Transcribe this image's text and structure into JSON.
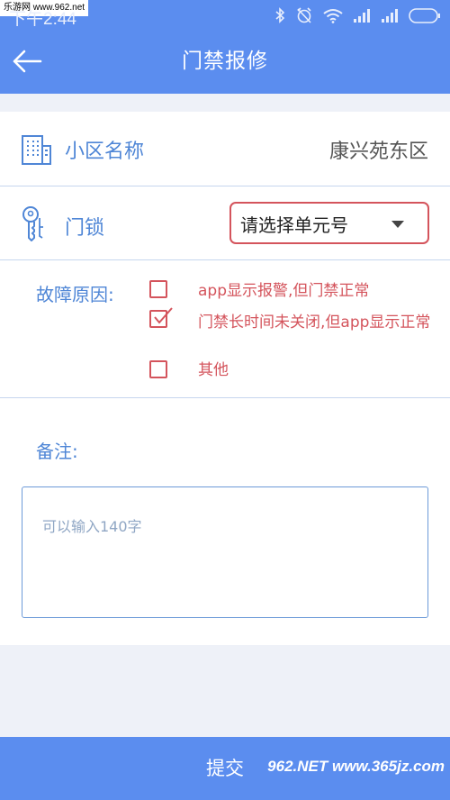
{
  "status_bar": {
    "watermark": "乐游网 www.962.net",
    "time": "下午2:44"
  },
  "header": {
    "title": "门禁报修",
    "back_icon": "arrow-left-icon"
  },
  "community": {
    "label": "小区名称",
    "value": "康兴苑东区",
    "icon": "building-icon"
  },
  "lock": {
    "label": "门锁",
    "select_value": "请选择单元号",
    "icon": "key-icon"
  },
  "fault": {
    "label": "故障原因:",
    "options": [
      {
        "label": "app显示报警,但门禁正常",
        "checked": false
      },
      {
        "label": "门禁长时间未关闭,但app显示正常",
        "checked": true
      },
      {
        "label": "其他",
        "checked": false
      }
    ]
  },
  "remark": {
    "label": "备注:",
    "placeholder": "可以输入140字"
  },
  "footer": {
    "submit_label": "提交",
    "site_watermark": "962.NET www.365jz.com"
  },
  "colors": {
    "accent": "#5b8def",
    "label_blue": "#4f86d6",
    "option_red": "#d4545c"
  }
}
